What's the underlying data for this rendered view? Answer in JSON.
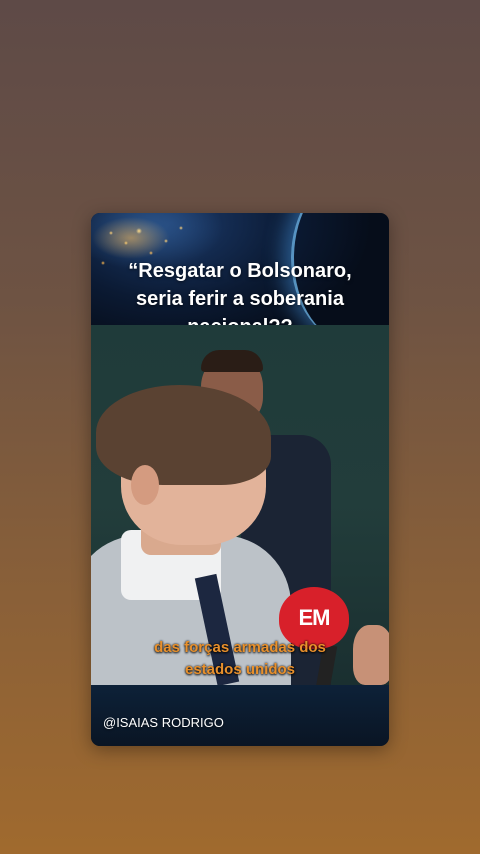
{
  "post": {
    "title_lines": [
      "“Resgatar o Bolsonaro,",
      "seria ferir a soberania",
      "nacional??"
    ],
    "caption_lines": [
      "das forças armadas dos",
      "estados unidos"
    ],
    "author_handle": "@ISAIAS RODRIGO",
    "mic_logo": "EM"
  },
  "colors": {
    "caption": "#e8902c",
    "title": "#ffffff",
    "mic": "#d8202a"
  }
}
